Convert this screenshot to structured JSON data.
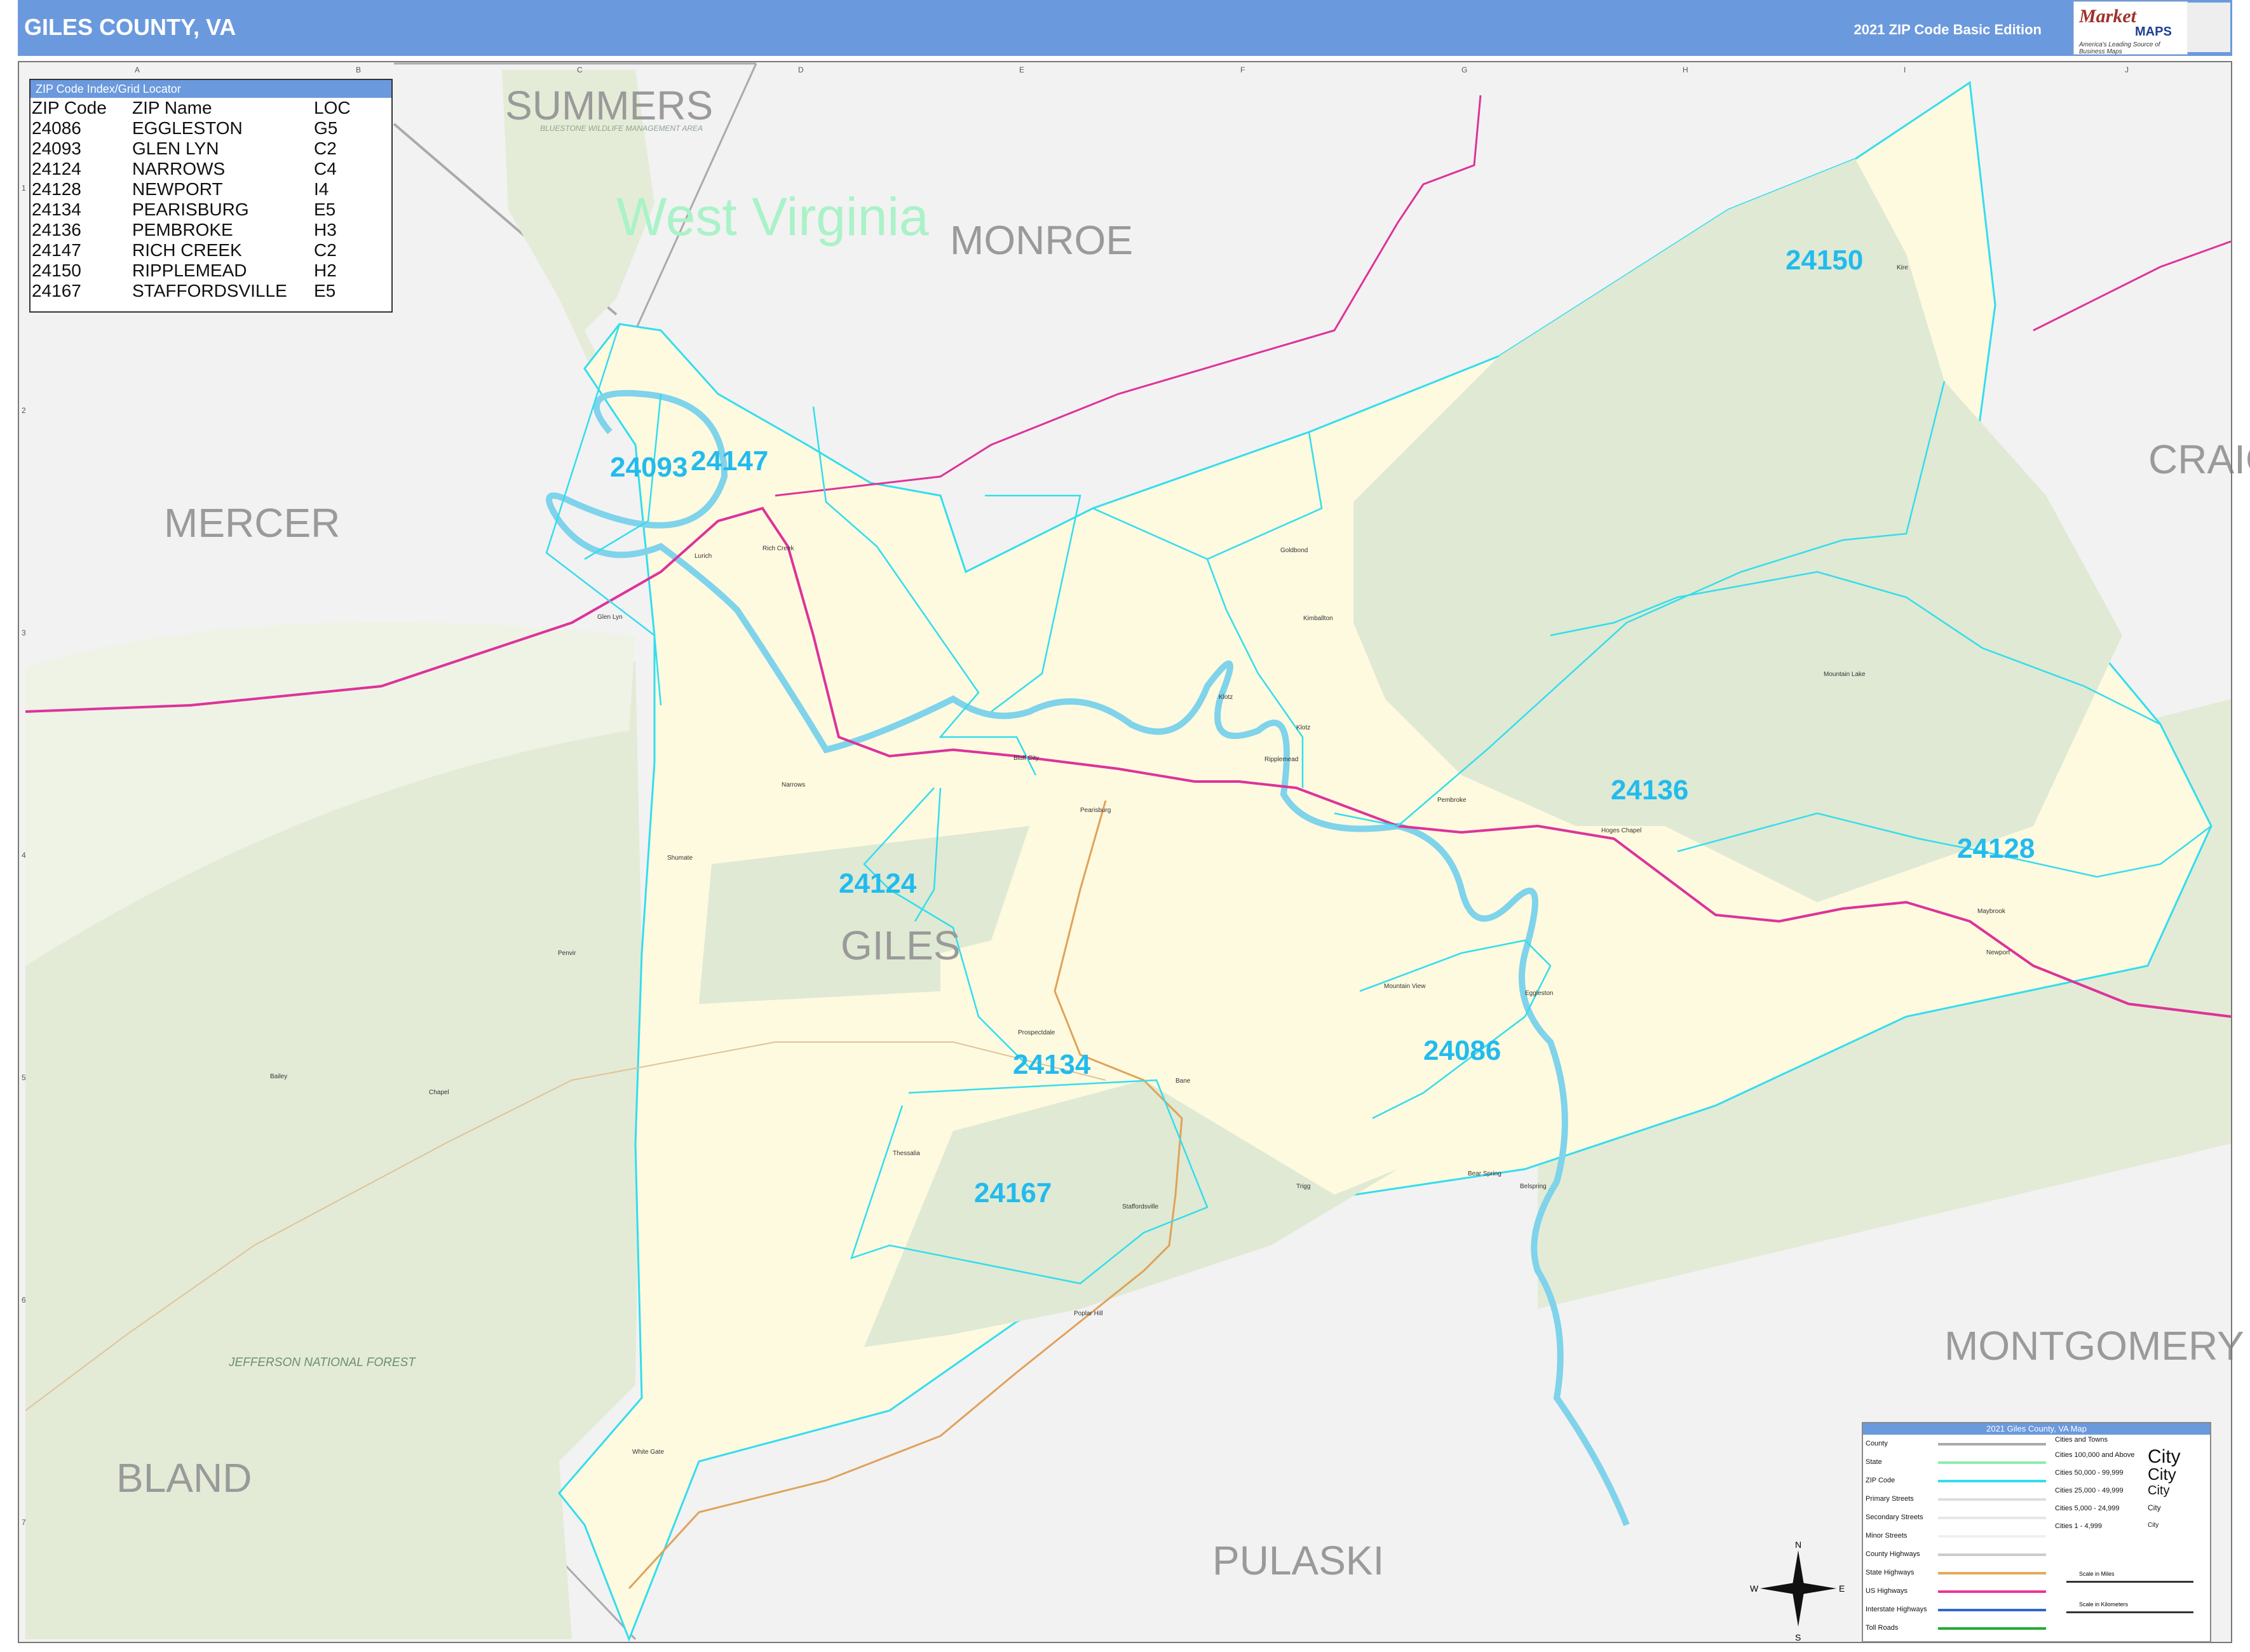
{
  "header": {
    "title": "GILES COUNTY, VA",
    "edition": "2021 ZIP Code Basic Edition",
    "logo_main": "Market",
    "logo_sub": "MAPS",
    "logo_tagline": "America's Leading Source of Business Maps"
  },
  "grid": {
    "columns": [
      "A",
      "B",
      "C",
      "D",
      "E",
      "F",
      "G",
      "H",
      "I",
      "J"
    ],
    "rows": [
      "1",
      "2",
      "3",
      "4",
      "5",
      "6",
      "7"
    ]
  },
  "map": {
    "state_label": "West Virginia",
    "counties": {
      "summers": "SUMMERS",
      "monroe": "MONROE",
      "mercer": "MERCER",
      "giles": "GILES",
      "craig": "CRAIG",
      "montgomery": "MONTGOMERY",
      "bland": "BLAND",
      "pulaski": "PULASKI"
    },
    "zips": {
      "z24150": "24150",
      "z24093": "24093",
      "z24147": "24147",
      "z24136": "24136",
      "z24128": "24128",
      "z24124": "24124",
      "z24134": "24134",
      "z24086": "24086",
      "z24167": "24167"
    },
    "places": {
      "rich_creek": "Rich Creek",
      "lurich": "Lurich",
      "glen_lyn": "Glen Lyn",
      "narrows": "Narrows",
      "pearisburg": "Pearisburg",
      "bluff_city": "Bluff City",
      "ripplemead": "Ripplemead",
      "kimballton": "Kimballton",
      "goldbond": "Goldbond",
      "klotz": "Klotz",
      "pembroke": "Pembroke",
      "hoges_chapel": "Hoges Chapel",
      "mountain_lake": "Mountain Lake",
      "kire": "Kire",
      "maybrook": "Maybrook",
      "newport": "Newport",
      "mountain_view": "Mountain View",
      "eggleston": "Eggleston",
      "prospectdale": "Prospectdale",
      "bane": "Bane",
      "staffordsville": "Staffordsville",
      "thessalia": "Thessalia",
      "trigg": "Trigg",
      "bear_spring": "Bear Spring",
      "belspring": "Belspring",
      "poplar_hill": "Poplar Hill",
      "white_gate": "White Gate",
      "shumate": "Shumate",
      "penvir": "Penvir",
      "bailey": "Bailey",
      "chapel": "Chapel",
      "bluestone": "BLUESTONE WILDLIFE MANAGEMENT AREA",
      "jefferson": "JEFFERSON NATIONAL FOREST"
    }
  },
  "index": {
    "title": "ZIP Code Index/Grid Locator",
    "headers": [
      "ZIP Code",
      "ZIP Name",
      "LOC"
    ],
    "rows": [
      [
        "24086",
        "EGGLESTON",
        "G5"
      ],
      [
        "24093",
        "GLEN LYN",
        "C2"
      ],
      [
        "24124",
        "NARROWS",
        "C4"
      ],
      [
        "24128",
        "NEWPORT",
        "I4"
      ],
      [
        "24134",
        "PEARISBURG",
        "E5"
      ],
      [
        "24136",
        "PEMBROKE",
        "H3"
      ],
      [
        "24147",
        "RICH CREEK",
        "C2"
      ],
      [
        "24150",
        "RIPPLEMEAD",
        "H2"
      ],
      [
        "24167",
        "STAFFORDSVILLE",
        "E5"
      ]
    ]
  },
  "legend": {
    "title": "2021 Giles County, VA Map",
    "items": [
      {
        "label": "County",
        "color": "#aaaaaa"
      },
      {
        "label": "State",
        "color": "#88eeaa"
      },
      {
        "label": "ZIP Code",
        "color": "#33ddee"
      },
      {
        "label": "Primary Streets",
        "color": "#dddddd"
      },
      {
        "label": "Secondary Streets",
        "color": "#e6e6e6"
      },
      {
        "label": "Minor Streets",
        "color": "#f0f0f0"
      },
      {
        "label": "County Highways",
        "color": "#cccccc"
      },
      {
        "label": "State Highways",
        "color": "#e8a95a"
      },
      {
        "label": "US Highways",
        "color": "#ee3399"
      },
      {
        "label": "Interstate Highways",
        "color": "#3366cc"
      },
      {
        "label": "Toll Roads",
        "color": "#22aa33"
      }
    ],
    "towns_title": "Cities and Towns",
    "towns": [
      {
        "label": "Cities 100,000 and Above",
        "sample": "City"
      },
      {
        "label": "Cities 50,000 - 99,999",
        "sample": "City"
      },
      {
        "label": "Cities 25,000 - 49,999",
        "sample": "City"
      },
      {
        "label": "Cities 5,000 - 24,999",
        "sample": "City"
      },
      {
        "label": "Cities 1 - 4,999",
        "sample": "City"
      }
    ],
    "scale_miles": "Scale in Miles",
    "scale_km": "Scale in Kilometers"
  },
  "compass": {
    "n": "N",
    "s": "S",
    "e": "E",
    "w": "W"
  }
}
